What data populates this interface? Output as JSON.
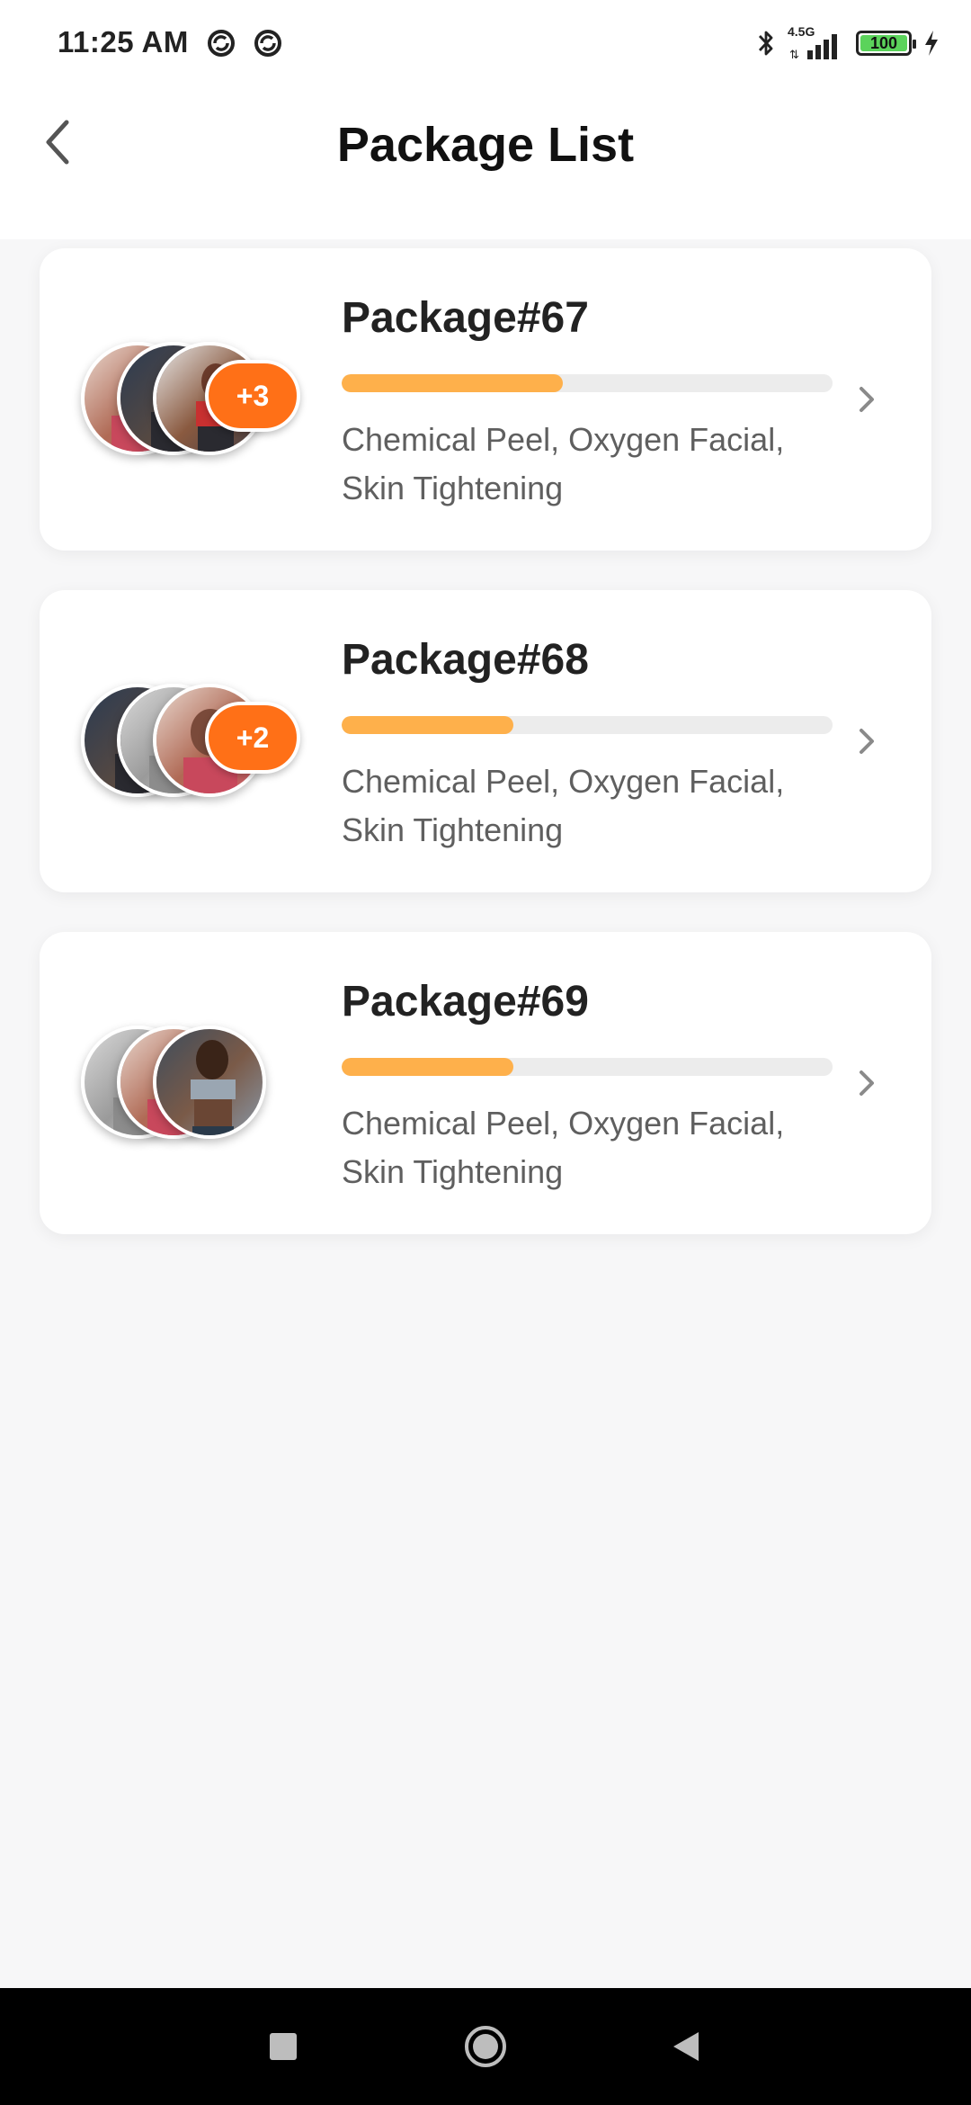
{
  "status_bar": {
    "time": "11:25 AM",
    "network": "4.5G",
    "battery": "100",
    "battery_level": 1.0,
    "icons": [
      "sync-icon",
      "sync-icon",
      "bluetooth-icon",
      "signal-icon",
      "battery-icon",
      "charging-icon"
    ]
  },
  "header": {
    "title": "Package List",
    "back_icon": "back-arrow-icon"
  },
  "packages": [
    {
      "title": "Package#67",
      "progress": 0.45,
      "description": "Chemical Peel, Oxygen Facial, Skin Tightening",
      "extra_count": "+3",
      "avatars": [
        "woman-red-top",
        "man-dark-gym",
        "woman-fitness"
      ]
    },
    {
      "title": "Package#68",
      "progress": 0.35,
      "description": "Chemical Peel, Oxygen Facial, Skin Tightening",
      "extra_count": "+2",
      "avatars": [
        "man-dark-gym",
        "man-gym-bw",
        "woman-red-top"
      ]
    },
    {
      "title": "Package#69",
      "progress": 0.35,
      "description": "Chemical Peel, Oxygen Facial, Skin Tightening",
      "extra_count": "",
      "avatars": [
        "man-gym-bw",
        "woman-red-top",
        "woman-abs"
      ]
    }
  ],
  "colors": {
    "accent_orange": "#ff7017",
    "progress_fill": "#feb04b",
    "progress_track": "#ececec",
    "title_text": "#222222",
    "description_text": "#5f5f5f"
  },
  "nav_bar": {
    "icons": [
      "recents-square-icon",
      "home-circle-icon",
      "back-triangle-icon"
    ]
  }
}
